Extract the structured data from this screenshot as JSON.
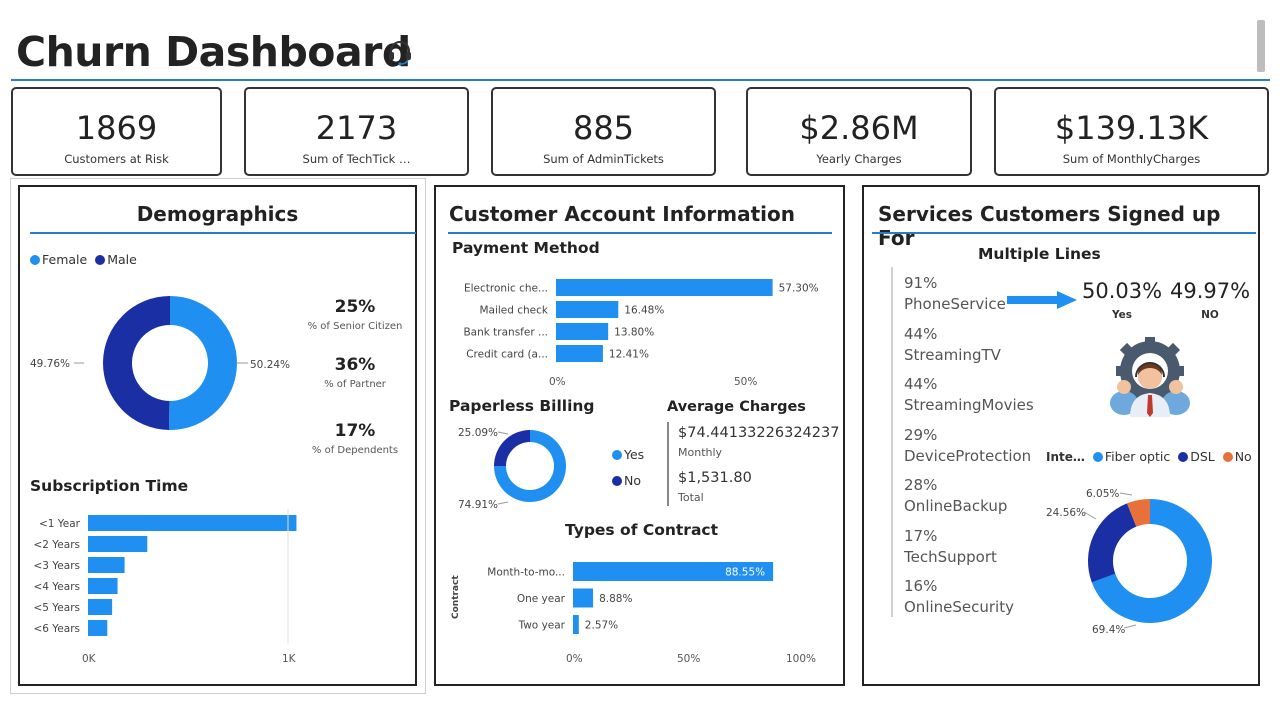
{
  "header": {
    "title": "Churn Dashboard",
    "icon": "headset-icon"
  },
  "kpis": [
    {
      "value": "1869",
      "label": "Customers at Risk"
    },
    {
      "value": "2173",
      "label": "Sum of TechTick …"
    },
    {
      "value": "885",
      "label": "Sum of AdminTickets"
    },
    {
      "value": "$2.86M",
      "label": "Yearly Charges"
    },
    {
      "value": "$139.13K",
      "label": "Sum of MonthlyCharges"
    }
  ],
  "demographics": {
    "title": "Demographics",
    "legend": [
      {
        "label": "Female",
        "color": "#1f8ff2"
      },
      {
        "label": "Male",
        "color": "#1a2fa3"
      }
    ],
    "gender_donut": {
      "female_pct": 50.24,
      "male_pct": 49.76,
      "female_label": "50.24%",
      "male_label": "49.76%"
    },
    "stats": [
      {
        "value": "25%",
        "label": "% of Senior Citizen"
      },
      {
        "value": "36%",
        "label": "% of Partner"
      },
      {
        "value": "17%",
        "label": "% of Dependents"
      }
    ],
    "subscription_title": "Subscription Time",
    "subscription_axis": [
      "0K",
      "1K"
    ]
  },
  "account": {
    "title": "Customer Account Information",
    "payment_title": "Payment Method",
    "payment_axis": [
      "0%",
      "50%"
    ],
    "paperless_title": "Paperless Billing",
    "paperless_donut": {
      "yes_pct": 74.91,
      "no_pct": 25.09,
      "yes_label": "74.91%",
      "no_label": "25.09%"
    },
    "paperless_legend": [
      {
        "label": "Yes",
        "color": "#1f8ff2"
      },
      {
        "label": "No",
        "color": "#1a2fa3"
      }
    ],
    "avg_title": "Average Charges",
    "avg_monthly_value": "$74.44133226324237",
    "avg_monthly_label": "Monthly",
    "avg_total_value": "$1,531.80",
    "avg_total_label": "Total",
    "contract_title": "Types of Contract",
    "contract_ylabel": "Contract",
    "contract_axis": [
      "0%",
      "50%",
      "100%"
    ]
  },
  "services": {
    "title": "Services Customers Signed up For",
    "multiple_lines_title": "Multiple Lines",
    "list": [
      {
        "pct": "91%",
        "name": "PhoneService"
      },
      {
        "pct": "44%",
        "name": "StreamingTV"
      },
      {
        "pct": "44%",
        "name": "StreamingMovies"
      },
      {
        "pct": "29%",
        "name": "DeviceProtection"
      },
      {
        "pct": "28%",
        "name": "OnlineBackup"
      },
      {
        "pct": "17%",
        "name": "TechSupport"
      },
      {
        "pct": "16%",
        "name": "OnlineSecurity"
      }
    ],
    "multiple_yes_value": "50.03%",
    "multiple_yes_label": "Yes",
    "multiple_no_value": "49.97%",
    "multiple_no_label": "NO",
    "internet_legend_title": "Inte…",
    "internet_legend": [
      {
        "label": "Fiber optic",
        "color": "#1f8ff2"
      },
      {
        "label": "DSL",
        "color": "#1a2fa3"
      },
      {
        "label": "No",
        "color": "#e8703a"
      }
    ],
    "internet_donut": {
      "fiber_pct": 69.4,
      "dsl_pct": 24.56,
      "no_pct": 6.05,
      "fiber_label": "69.4%",
      "dsl_label": "24.56%",
      "no_label": "6.05%"
    }
  },
  "chart_data": [
    {
      "type": "bar",
      "title": "Subscription Time",
      "categories": [
        "<1 Year",
        "<2 Years",
        "<3 Years",
        "<4 Years",
        "<5 Years",
        "<6 Years"
      ],
      "values": [
        1037,
        295,
        182,
        147,
        120,
        96
      ],
      "xlim": [
        0,
        1000
      ]
    },
    {
      "type": "bar",
      "title": "Payment Method",
      "categories": [
        "Electronic che...",
        "Mailed check",
        "Bank transfer ...",
        "Credit card (a..."
      ],
      "values": [
        57.3,
        16.48,
        13.8,
        12.41
      ],
      "labels": [
        "57.30%",
        "16.48%",
        "13.80%",
        "12.41%"
      ],
      "xlim": [
        0,
        50
      ]
    },
    {
      "type": "bar",
      "title": "Types of Contract",
      "categories": [
        "Month-to-mo...",
        "One year",
        "Two year"
      ],
      "values": [
        88.55,
        8.88,
        2.57
      ],
      "labels": [
        "88.55%",
        "8.88%",
        "2.57%"
      ],
      "ylabel": "Contract",
      "xlim": [
        0,
        100
      ]
    }
  ]
}
